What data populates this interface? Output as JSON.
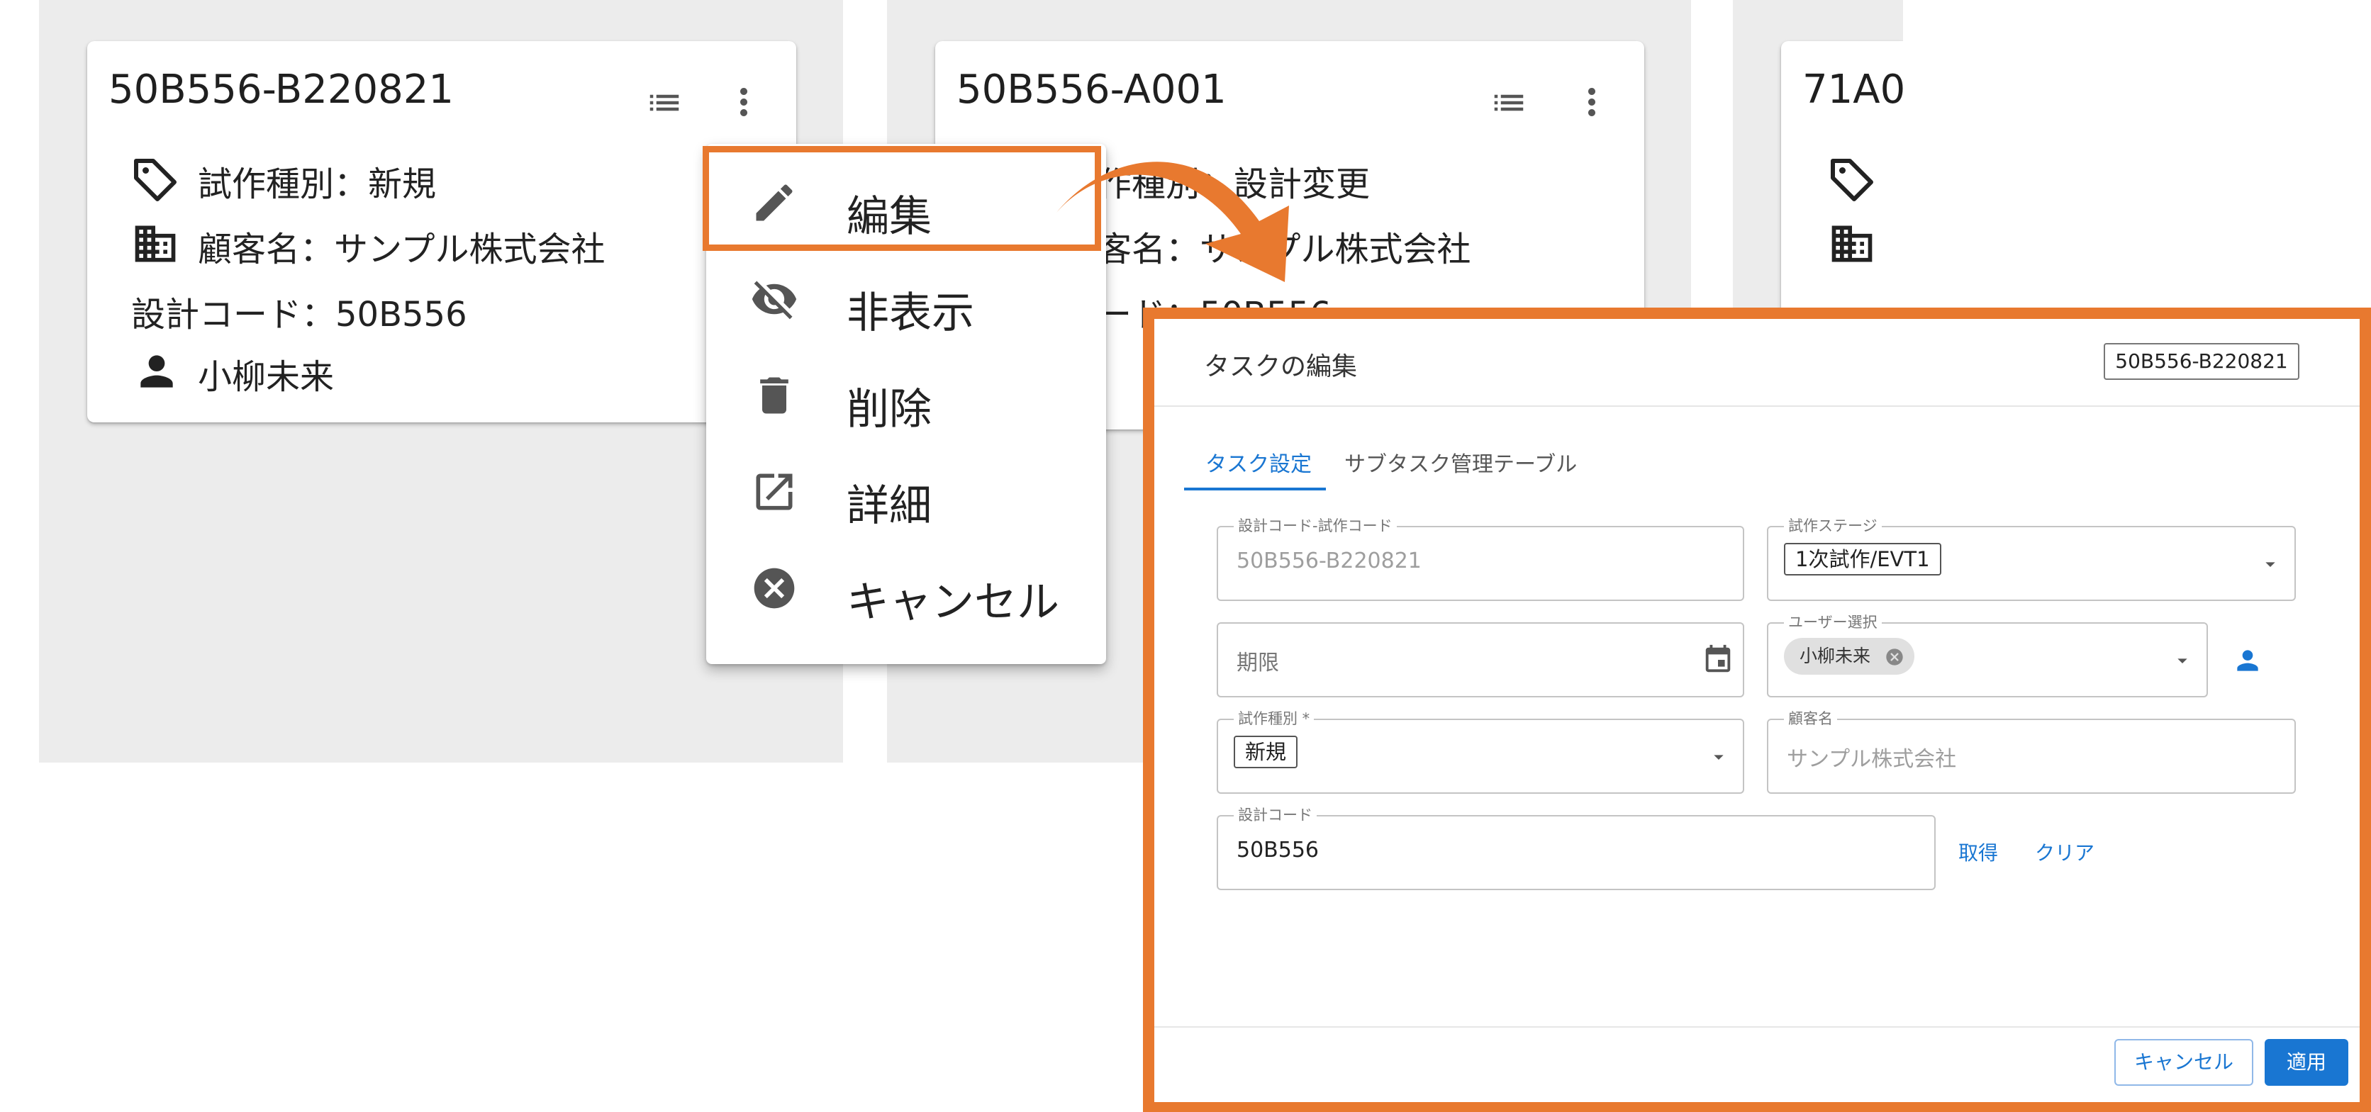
{
  "cards": [
    {
      "title": "50B556-B220821",
      "type_line": "試作種別：新規",
      "customer_line": "顧客名：サンプル株式会社",
      "code_line": "設計コード：50B556",
      "user_line": "小柳未来"
    },
    {
      "title": "50B556-A001",
      "type_line": "作種別：設計変更",
      "customer_line": "客名：サンプル株式会社",
      "code_line": "ード：50B556"
    },
    {
      "title": "71A0"
    }
  ],
  "menu": {
    "items": [
      {
        "label": "編集",
        "icon": "pencil-icon"
      },
      {
        "label": "非表示",
        "icon": "eye-off-icon"
      },
      {
        "label": "削除",
        "icon": "trash-icon"
      },
      {
        "label": "詳細",
        "icon": "open-in-new-icon"
      },
      {
        "label": "キャンセル",
        "icon": "cancel-circle-icon"
      }
    ]
  },
  "accent_colors": {
    "highlight": "#e8792f",
    "primary": "#1976d2"
  },
  "dialog": {
    "title": "タスクの編集",
    "code_badge": "50B556-B220821",
    "tabs": [
      {
        "label": "タスク設定",
        "active": true
      },
      {
        "label": "サブタスク管理テーブル",
        "active": false
      }
    ],
    "fields": {
      "design_trial_code": {
        "label": "設計コード-試作コード",
        "value": "50B556-B220821"
      },
      "trial_stage": {
        "label": "試作ステージ",
        "value": "1次試作/EVT1"
      },
      "deadline": {
        "label": "",
        "placeholder": "期限"
      },
      "user_select": {
        "label": "ユーザー選択",
        "chip": "小柳未来"
      },
      "trial_type": {
        "label": "試作種別 *",
        "value": "新規"
      },
      "customer": {
        "label": "顧客名",
        "value": "サンプル株式会社"
      },
      "design_code": {
        "label": "設計コード",
        "value": "50B556"
      }
    },
    "get_button": "取得",
    "clear_button": "クリア",
    "cancel_button": "キャンセル",
    "apply_button": "適用"
  }
}
